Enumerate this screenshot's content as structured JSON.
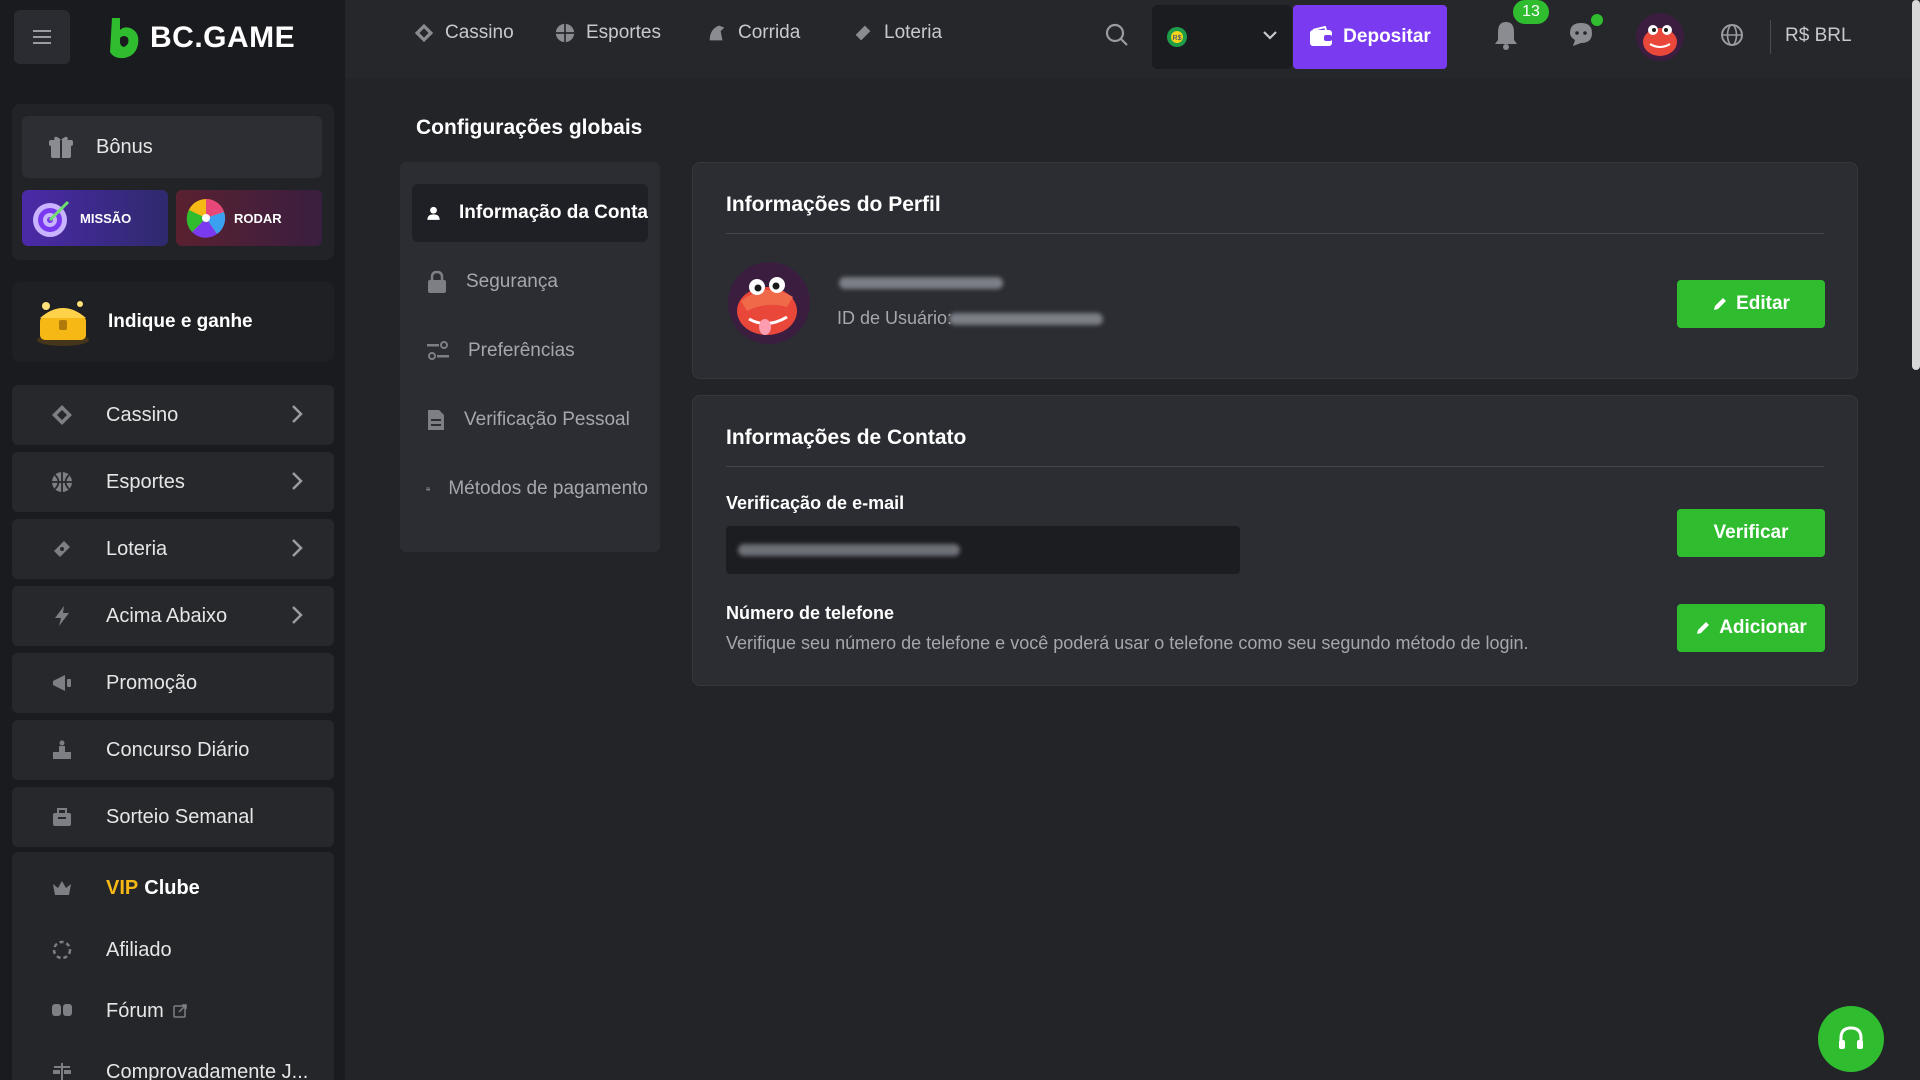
{
  "brand": {
    "name": "BC.GAME"
  },
  "topnav": {
    "items": [
      {
        "label": "Cassino",
        "icon": "casino-icon"
      },
      {
        "label": "Esportes",
        "icon": "sports-icon"
      },
      {
        "label": "Corrida",
        "icon": "horse-racing-icon"
      },
      {
        "label": "Loteria",
        "icon": "lottery-icon"
      }
    ],
    "deposit_label": "Depositar",
    "notification_count": "13",
    "currency_label": "R$ BRL",
    "currency_chip": "R$"
  },
  "sidebar": {
    "bonus_label": "Bônus",
    "mission_label": "MISSÃO",
    "spin_label": "RODAR",
    "refer_label": "Indique e ganhe",
    "items": [
      {
        "label": "Cassino",
        "icon": "casino-icon",
        "has_children": true
      },
      {
        "label": "Esportes",
        "icon": "sports-icon",
        "has_children": true
      },
      {
        "label": "Loteria",
        "icon": "lottery-icon",
        "has_children": true
      },
      {
        "label": "Acima Abaixo",
        "icon": "lightning-icon",
        "has_children": true
      },
      {
        "label": "Promoção",
        "icon": "promotion-icon",
        "has_children": false
      },
      {
        "label": "Concurso Diário",
        "icon": "contest-icon",
        "has_children": false
      },
      {
        "label": "Sorteio Semanal",
        "icon": "raffle-icon",
        "has_children": false
      }
    ],
    "vip_word": "VIP",
    "vip_club": "Clube",
    "affiliate_label": "Afiliado",
    "forum_label": "Fórum",
    "provably_label": "Comprovadamente J..."
  },
  "settings": {
    "page_title": "Configurações globais",
    "nav": [
      {
        "label": "Informação da Conta",
        "icon": "user-icon",
        "active": true
      },
      {
        "label": "Segurança",
        "icon": "lock-icon",
        "active": false
      },
      {
        "label": "Preferências",
        "icon": "sliders-icon",
        "active": false
      },
      {
        "label": "Verificação Pessoal",
        "icon": "document-icon",
        "active": false
      },
      {
        "label": "Métodos de pagamento",
        "icon": "card-icon",
        "active": false
      }
    ]
  },
  "profile": {
    "title": "Informações do Perfil",
    "user_id_label": "ID de Usuário:",
    "edit_label": "Editar"
  },
  "contact": {
    "title": "Informações de Contato",
    "email_label": "Verificação de e-mail",
    "verify_label": "Verificar",
    "phone_label": "Número de telefone",
    "phone_desc": "Verifique seu número de telefone e você poderá usar o telefone como seu segundo método de login.",
    "add_label": "Adicionar"
  },
  "colors": {
    "accent_green": "#2fbd2f",
    "deposit_purple": "#7a3bf0",
    "vip_gold": "#f5b814",
    "background": "#232428"
  }
}
